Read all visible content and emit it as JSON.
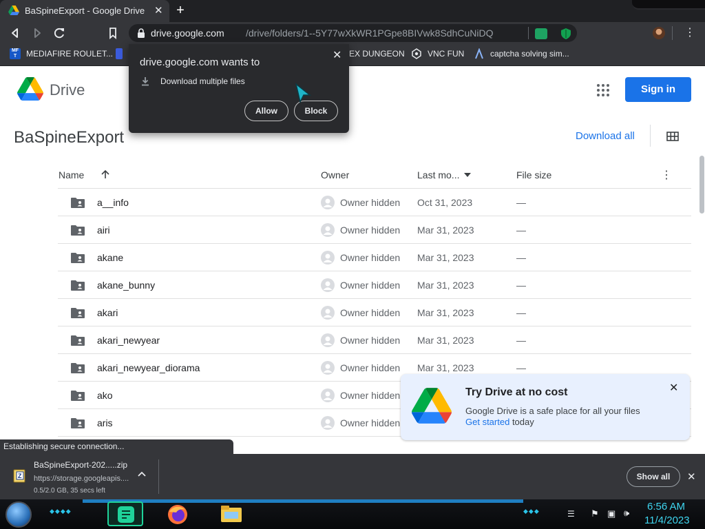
{
  "browser": {
    "tab_title": "BaSpineExport - Google Drive",
    "url_host": "drive.google.com",
    "url_path": "/drive/folders/1--5Y77wXkWR1PGpe8BIVwk8SdhCuNiDQ"
  },
  "bookmarks": [
    {
      "label": "MEDIAFIRE ROULET..."
    },
    {
      "label": "EX DUNGEON"
    },
    {
      "label": "VNC FUN"
    },
    {
      "label": "captcha solving sim..."
    }
  ],
  "permission_popup": {
    "title": "drive.google.com wants to",
    "item": "Download multiple files",
    "allow": "Allow",
    "block": "Block"
  },
  "drive": {
    "wordmark": "Drive",
    "sign_in": "Sign in",
    "folder_title": "BaSpineExport",
    "download_all": "Download all",
    "columns": {
      "name": "Name",
      "owner": "Owner",
      "modified": "Last mo...",
      "size": "File size"
    },
    "rows": [
      {
        "name": "a__info",
        "owner": "Owner hidden",
        "modified": "Oct 31, 2023",
        "size": "—"
      },
      {
        "name": "airi",
        "owner": "Owner hidden",
        "modified": "Mar 31, 2023",
        "size": "—"
      },
      {
        "name": "akane",
        "owner": "Owner hidden",
        "modified": "Mar 31, 2023",
        "size": "—"
      },
      {
        "name": "akane_bunny",
        "owner": "Owner hidden",
        "modified": "Mar 31, 2023",
        "size": "—"
      },
      {
        "name": "akari",
        "owner": "Owner hidden",
        "modified": "Mar 31, 2023",
        "size": "—"
      },
      {
        "name": "akari_newyear",
        "owner": "Owner hidden",
        "modified": "Mar 31, 2023",
        "size": "—"
      },
      {
        "name": "akari_newyear_diorama",
        "owner": "Owner hidden",
        "modified": "Mar 31, 2023",
        "size": "—"
      },
      {
        "name": "ako",
        "owner": "Owner hidden",
        "modified": "",
        "size": ""
      },
      {
        "name": "aris",
        "owner": "Owner hidden",
        "modified": "",
        "size": ""
      }
    ]
  },
  "promo": {
    "title": "Try Drive at no cost",
    "text": "Google Drive is a safe place for all your files",
    "link": "Get started",
    "suffix": "today"
  },
  "status_text": "Establishing secure connection...",
  "download": {
    "filename": "BaSpineExport-202.....zip",
    "url": "https://storage.googleapis....",
    "progress": "0.5/2.0 GB, 35 secs left",
    "show_all": "Show all"
  },
  "taskbar": {
    "time": "6:56 AM",
    "date": "11/4/2023"
  },
  "colors": {
    "accent": "#1a73e8",
    "browser_dark": "#35363a",
    "clock": "#3fd6f0"
  }
}
